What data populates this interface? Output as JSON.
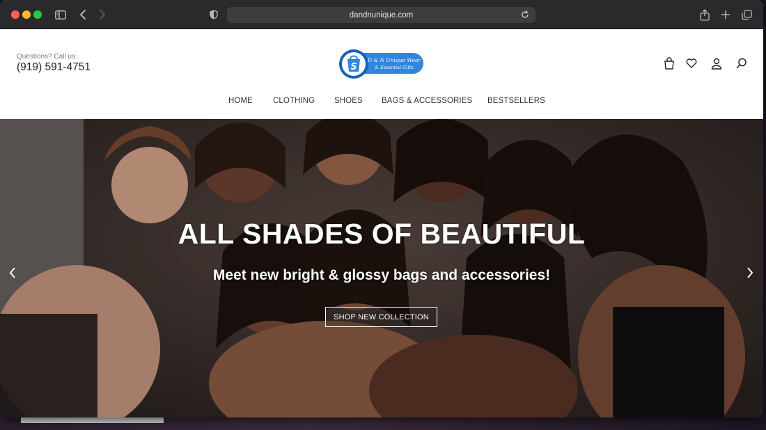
{
  "browser": {
    "url": "dandnunique.com",
    "icons": [
      "sidebar-icon",
      "chevron-left-icon",
      "chevron-right-icon",
      "shield-icon",
      "reload-icon",
      "share-icon",
      "plus-icon",
      "tabs-icon"
    ]
  },
  "header": {
    "contact_label": "Questions? Call us:",
    "contact_phone": "(919) 591-4751",
    "logo": {
      "line1": "D & N Unique Wear",
      "line2": "& Essential Gifts",
      "brand_color": "#2e86e0",
      "badge_color": "#1a5fc0"
    },
    "icons": [
      "cart-icon",
      "heart-icon",
      "user-icon",
      "search-icon"
    ]
  },
  "nav": {
    "items": [
      {
        "label": "HOME"
      },
      {
        "label": "CLOTHING"
      },
      {
        "label": "SHOES"
      },
      {
        "label": "BAGS & ACCESSORIES"
      },
      {
        "label": "BESTSELLERS"
      }
    ]
  },
  "hero": {
    "title": "ALL SHADES OF BEAUTIFUL",
    "subtitle": "Meet new bright & glossy bags and accessories!",
    "cta_label": "SHOP NEW COLLECTION",
    "background_color": "#3b3230"
  }
}
